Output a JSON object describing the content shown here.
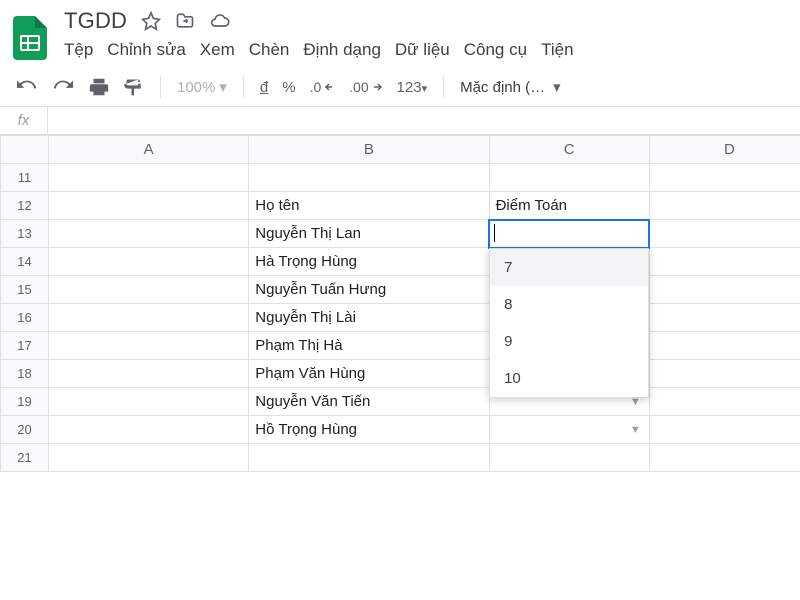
{
  "doc": {
    "title": "TGDD"
  },
  "menus": [
    "Tệp",
    "Chỉnh sửa",
    "Xem",
    "Chèn",
    "Định dạng",
    "Dữ liệu",
    "Công cụ",
    "Tiện"
  ],
  "toolbar": {
    "zoom": "100%",
    "currency": "đ",
    "percent": "%",
    "dec_dec": ".0",
    "dec_inc": ".00",
    "numfmt": "123",
    "font": "Mặc định (…"
  },
  "fx": {
    "label": "fx",
    "value": ""
  },
  "columns": [
    "A",
    "B",
    "C",
    "D"
  ],
  "rows": [
    {
      "n": 11,
      "A": "",
      "B": "",
      "C": "",
      "C_dd": false
    },
    {
      "n": 12,
      "A": "",
      "B": "Họ tên",
      "C": "Điểm Toán",
      "C_dd": false
    },
    {
      "n": 13,
      "A": "",
      "B": "Nguyễn Thị Lan",
      "C": "",
      "C_dd": false,
      "selected": true
    },
    {
      "n": 14,
      "A": "",
      "B": "Hà Trọng Hùng",
      "C": "",
      "C_dd": false
    },
    {
      "n": 15,
      "A": "",
      "B": "Nguyễn Tuấn Hưng",
      "C": "",
      "C_dd": false
    },
    {
      "n": 16,
      "A": "",
      "B": "Nguyễn Thị Lài",
      "C": "",
      "C_dd": false
    },
    {
      "n": 17,
      "A": "",
      "B": "Phạm Thị Hà",
      "C": "",
      "C_dd": false
    },
    {
      "n": 18,
      "A": "",
      "B": "Phạm Văn Hùng",
      "C": "",
      "C_dd": false
    },
    {
      "n": 19,
      "A": "",
      "B": "Nguyễn Văn Tiến",
      "C": "",
      "C_dd": true
    },
    {
      "n": 20,
      "A": "",
      "B": "Hồ Trọng Hùng",
      "C": "",
      "C_dd": true
    },
    {
      "n": 21,
      "A": "",
      "B": "",
      "C": "",
      "C_dd": false
    }
  ],
  "dropdown": {
    "options": [
      "7",
      "8",
      "9",
      "10"
    ],
    "hover_index": 0
  }
}
